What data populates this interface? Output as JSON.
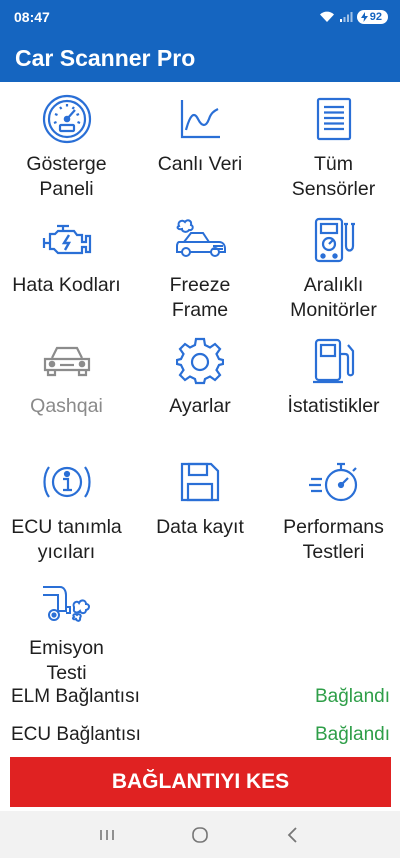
{
  "status": {
    "time": "08:47",
    "battery": "92"
  },
  "app": {
    "title": "Car Scanner Pro"
  },
  "menu": [
    {
      "label": "Gösterge\nPaneli",
      "icon": "gauge-icon"
    },
    {
      "label": "Canlı Veri",
      "icon": "line-chart-icon"
    },
    {
      "label": "Tüm\nSensörler",
      "icon": "document-list-icon"
    },
    {
      "label": "Hata Kodları",
      "icon": "engine-icon"
    },
    {
      "label": "Freeze\nFrame",
      "icon": "car-crash-icon"
    },
    {
      "label": "Aralıklı\nMonitörler",
      "icon": "multimeter-icon"
    },
    {
      "label": "Qashqai",
      "icon": "car-icon"
    },
    {
      "label": "Ayarlar",
      "icon": "gear-icon"
    },
    {
      "label": "İstatistikler",
      "icon": "fuel-pump-icon"
    },
    {
      "label": "ECU tanımla\nyıcıları",
      "icon": "info-icon"
    },
    {
      "label": "Data kayıt",
      "icon": "save-icon"
    },
    {
      "label": "Performans\nTestleri",
      "icon": "stopwatch-icon"
    },
    {
      "label": "Emisyon\nTesti",
      "icon": "exhaust-icon"
    }
  ],
  "connections": {
    "elm": {
      "label": "ELM Bağlantısı",
      "value": "Bağlandı"
    },
    "ecu": {
      "label": "ECU Bağlantısı",
      "value": "Bağlandı"
    }
  },
  "disconnect_label": "BAĞLANTIYI KES",
  "colors": {
    "primary": "#1565c0",
    "icon": "#2a6fd6",
    "connected": "#2e9e48",
    "danger": "#e02222"
  }
}
